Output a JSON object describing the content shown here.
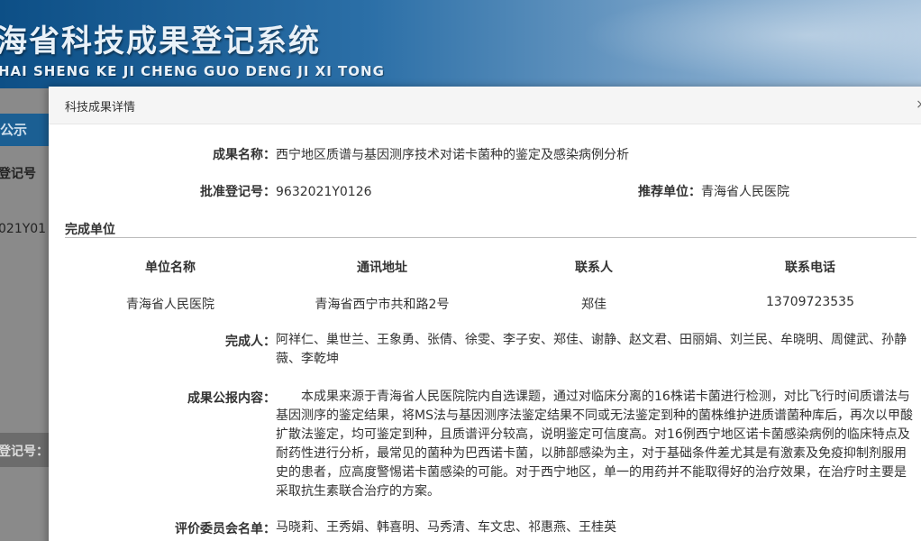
{
  "banner": {
    "title": "海省科技成果登记系统",
    "subtitle": "HAI SHENG KE JI CHENG GUO DENG JI XI TONG"
  },
  "background": {
    "tab": "公示",
    "label1": "登记号",
    "value1": "021Y01",
    "label2": "登记号："
  },
  "modal": {
    "title": "科技成果详情",
    "close": "×",
    "achievement_name_label": "成果名称：",
    "achievement_name": "西宁地区质谱与基因测序技术对诺卡菌种的鉴定及感染病例分析",
    "reg_no_label": "批准登记号：",
    "reg_no": "9632021Y0126",
    "recommend_label": "推荐单位：",
    "recommend": "青海省人民医院",
    "section_title": "完成单位",
    "table": {
      "headers": [
        "单位名称",
        "通讯地址",
        "联系人",
        "联系电话"
      ],
      "rows": [
        [
          "青海省人民医院",
          "青海省西宁市共和路2号",
          "郑佳",
          "13709723535"
        ]
      ]
    },
    "completers_label": "完成人：",
    "completers": "阿祥仁、巢世兰、王象勇、张倩、徐雯、李子安、郑佳、谢静、赵文君、田丽娟、刘兰民、牟晓明、周健武、孙静薇、李乾坤",
    "bulletin_label": "成果公报内容：",
    "bulletin": "　　本成果来源于青海省人民医院院内自选课题，通过对临床分离的16株诺卡菌进行检测，对比飞行时间质谱法与基因测序的鉴定结果，将MS法与基因测序法鉴定结果不同或无法鉴定到种的菌株维护进质谱菌种库后，再次以甲酸扩散法鉴定，均可鉴定到种，且质谱评分较高，说明鉴定可信度高。对16例西宁地区诺卡菌感染病例的临床特点及耐药性进行分析，最常见的菌种为巴西诺卡菌，以肺部感染为主，对于基础条件差尤其是有激素及免疫抑制剂服用史的患者，应高度警惕诺卡菌感染的可能。对于西宁地区，单一的用药并不能取得好的治疗效果，在治疗时主要是采取抗生素联合治疗的方案。",
    "committee_label": "评价委员会名单：",
    "committee": "马晓莉、王秀娟、韩喜明、马秀清、车文忠、祁惠燕、王桂英"
  }
}
